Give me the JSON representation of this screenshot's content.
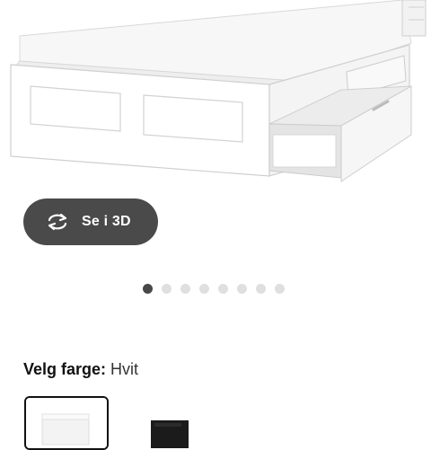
{
  "view3d": {
    "label": "Se i 3D",
    "icon": "rotate-3d-icon"
  },
  "gallery": {
    "image_count": 8,
    "active_index": 0
  },
  "color": {
    "heading": "Velg farge:",
    "selected": "Hvit",
    "swatches": [
      {
        "name": "white",
        "selected": true
      },
      {
        "name": "black",
        "selected": false
      }
    ]
  },
  "colors": {
    "button_bg": "#4a4a4a",
    "dot_active": "#484848",
    "dot_inactive": "#dfdfdf"
  }
}
